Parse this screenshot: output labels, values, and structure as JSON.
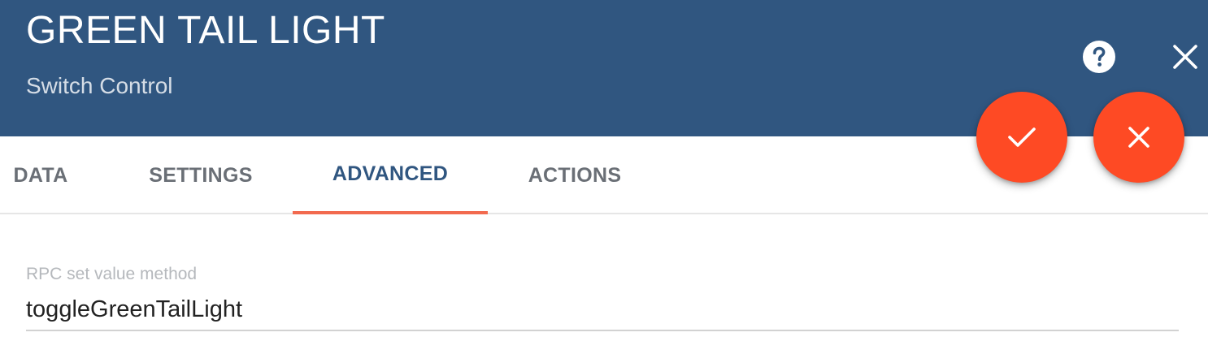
{
  "colors": {
    "header_bg": "#305680",
    "accent": "#fe4a24",
    "tab_active_text": "#305680",
    "tab_underline": "#f26a4f"
  },
  "header": {
    "title": "GREEN TAIL LIGHT",
    "subtitle": "Switch Control",
    "help_icon": "help-circle-icon",
    "close_icon": "close-icon"
  },
  "fab": {
    "apply_icon": "check-icon",
    "cancel_icon": "close-icon"
  },
  "tabs": [
    {
      "label": "DATA",
      "active": false
    },
    {
      "label": "SETTINGS",
      "active": false
    },
    {
      "label": "ADVANCED",
      "active": true
    },
    {
      "label": "ACTIONS",
      "active": false
    }
  ],
  "form": {
    "rpc_method": {
      "label": "RPC set value method",
      "value": "toggleGreenTailLight"
    }
  }
}
